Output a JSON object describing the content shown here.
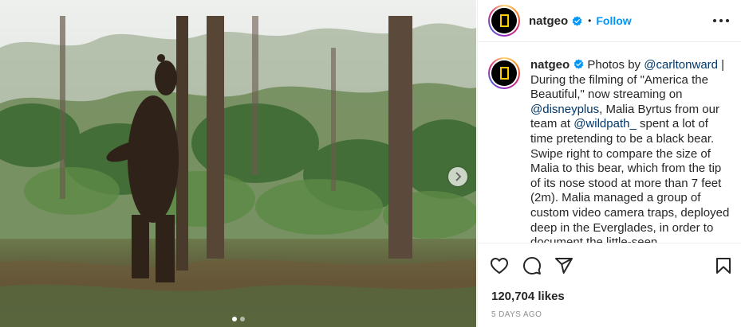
{
  "post": {
    "image_alt": "",
    "carousel": {
      "total_slides": 2,
      "active_index": 0
    },
    "next_icon": "chevron-right-icon"
  },
  "header": {
    "username": "natgeo",
    "verified_icon": "verified-badge-icon",
    "separator": "•",
    "follow_label": "Follow",
    "more_icon": "more-horizontal-icon"
  },
  "caption": {
    "username": "natgeo",
    "segments": [
      {
        "type": "text",
        "value": "Photos by "
      },
      {
        "type": "mention",
        "value": "@carltonward"
      },
      {
        "type": "text",
        "value": " | During the filming of \"America the Beautiful,\" now streaming on "
      },
      {
        "type": "mention",
        "value": "@disneyplus"
      },
      {
        "type": "text",
        "value": ", Malia Byrtus from our team at "
      },
      {
        "type": "mention",
        "value": "@wildpath_"
      },
      {
        "type": "text",
        "value": " spent a lot of time pretending to be a black bear. Swipe right to compare the size of Malia to this bear, which from the tip of its nose stood at more than 7 feet (2m). Malia managed a group of custom video camera traps, deployed deep in the Everglades, in order to document the little-seen"
      }
    ]
  },
  "actions": {
    "like_icon": "heart-icon",
    "comment_icon": "comment-icon",
    "share_icon": "share-icon",
    "save_icon": "bookmark-icon"
  },
  "likes_text": "120,704 likes",
  "timestamp": "5 DAYS AGO",
  "colors": {
    "accent": "#0095f6",
    "mention": "#00376b",
    "text": "#262626",
    "muted": "#8e8e8e",
    "natgeo_yellow": "#ffce00"
  }
}
